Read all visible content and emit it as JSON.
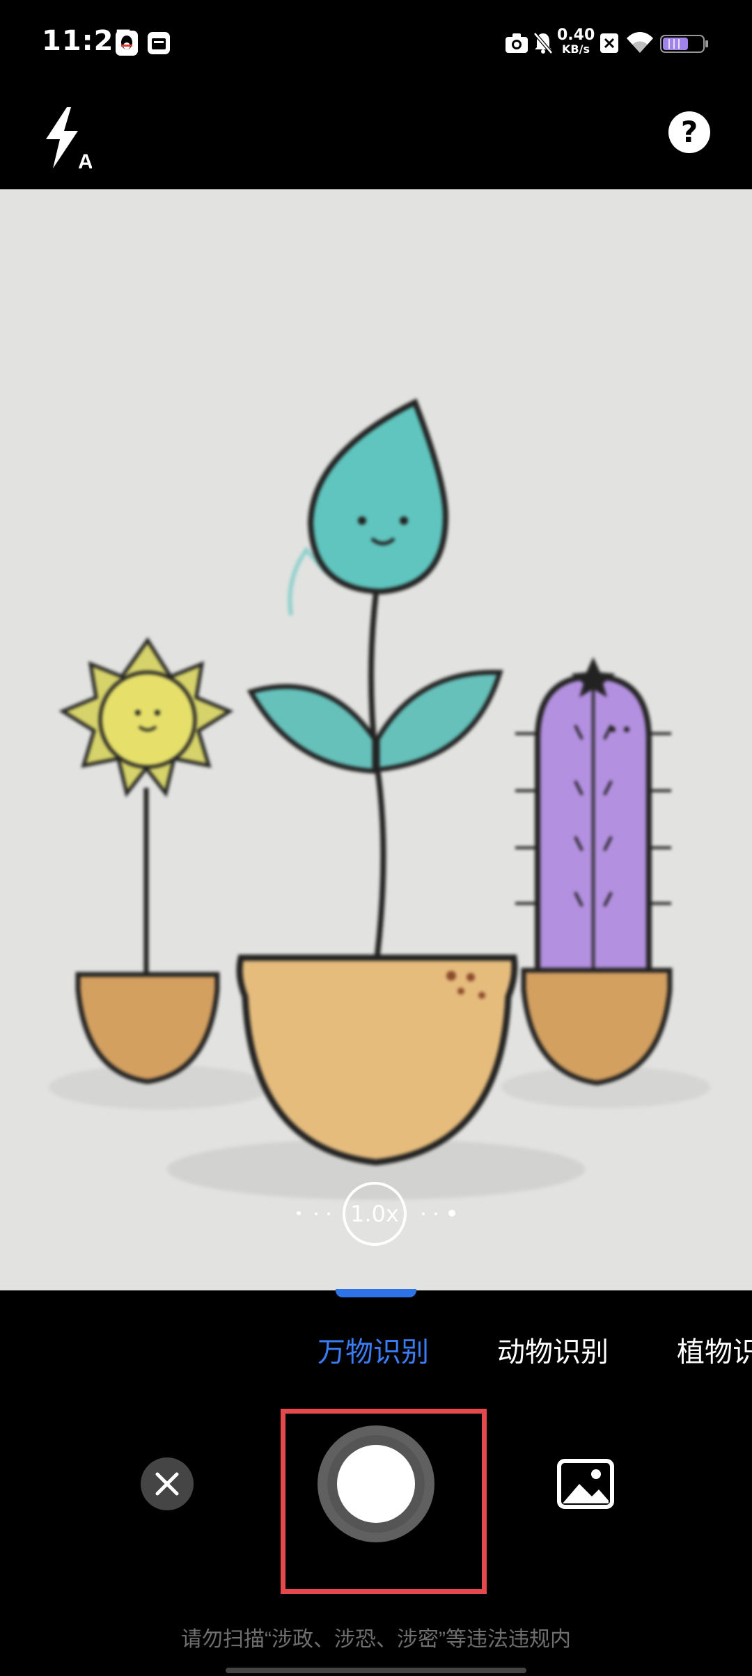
{
  "status_bar": {
    "time": "11:25",
    "net_speed_value": "0.40",
    "net_speed_unit": "KB/s",
    "icons": [
      "qq-icon",
      "calendar-app-icon",
      "camera-icon",
      "mute-icon",
      "close-box-icon",
      "wifi-icon",
      "battery-icon"
    ]
  },
  "top_controls": {
    "flash_mode_letter": "A",
    "help_label": "?"
  },
  "zoom": {
    "level": "1.0x"
  },
  "modes": {
    "items": [
      "万物识别",
      "动物识别",
      "植物识"
    ],
    "active_index": 0,
    "accent_color": "#3b7cf5"
  },
  "footer": {
    "notice": "请勿扫描“涉政、涉恐、涉密”等违法违规内"
  },
  "colors": {
    "highlight": "#e5494b"
  }
}
